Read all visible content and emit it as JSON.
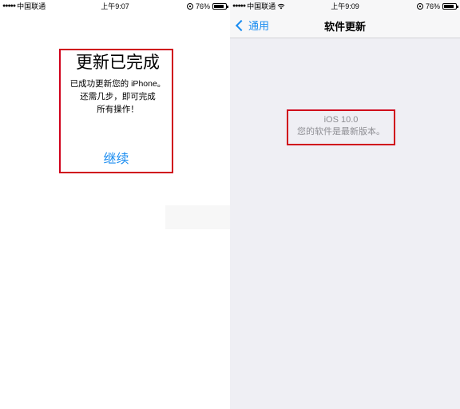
{
  "left": {
    "status": {
      "carrier": "中国联通",
      "time": "上午9:07",
      "battery": "76%",
      "battery_level": 0.76
    },
    "alert": {
      "title": "更新已完成",
      "message_lines": [
        "已成功更新您的 iPhone。",
        "还需几步，即可完成",
        "所有操作！"
      ],
      "button": "继续"
    }
  },
  "right": {
    "status": {
      "carrier": "中国联通",
      "time": "上午9:09",
      "battery": "76%",
      "battery_level": 0.76
    },
    "nav": {
      "back_label": "通用",
      "title": "软件更新"
    },
    "info": {
      "version": "iOS 10.0",
      "message": "您的软件是最新版本。"
    }
  },
  "colors": {
    "accent": "#1a8cf0",
    "highlight_border": "#d0021b",
    "settings_bg": "#efeff4"
  }
}
